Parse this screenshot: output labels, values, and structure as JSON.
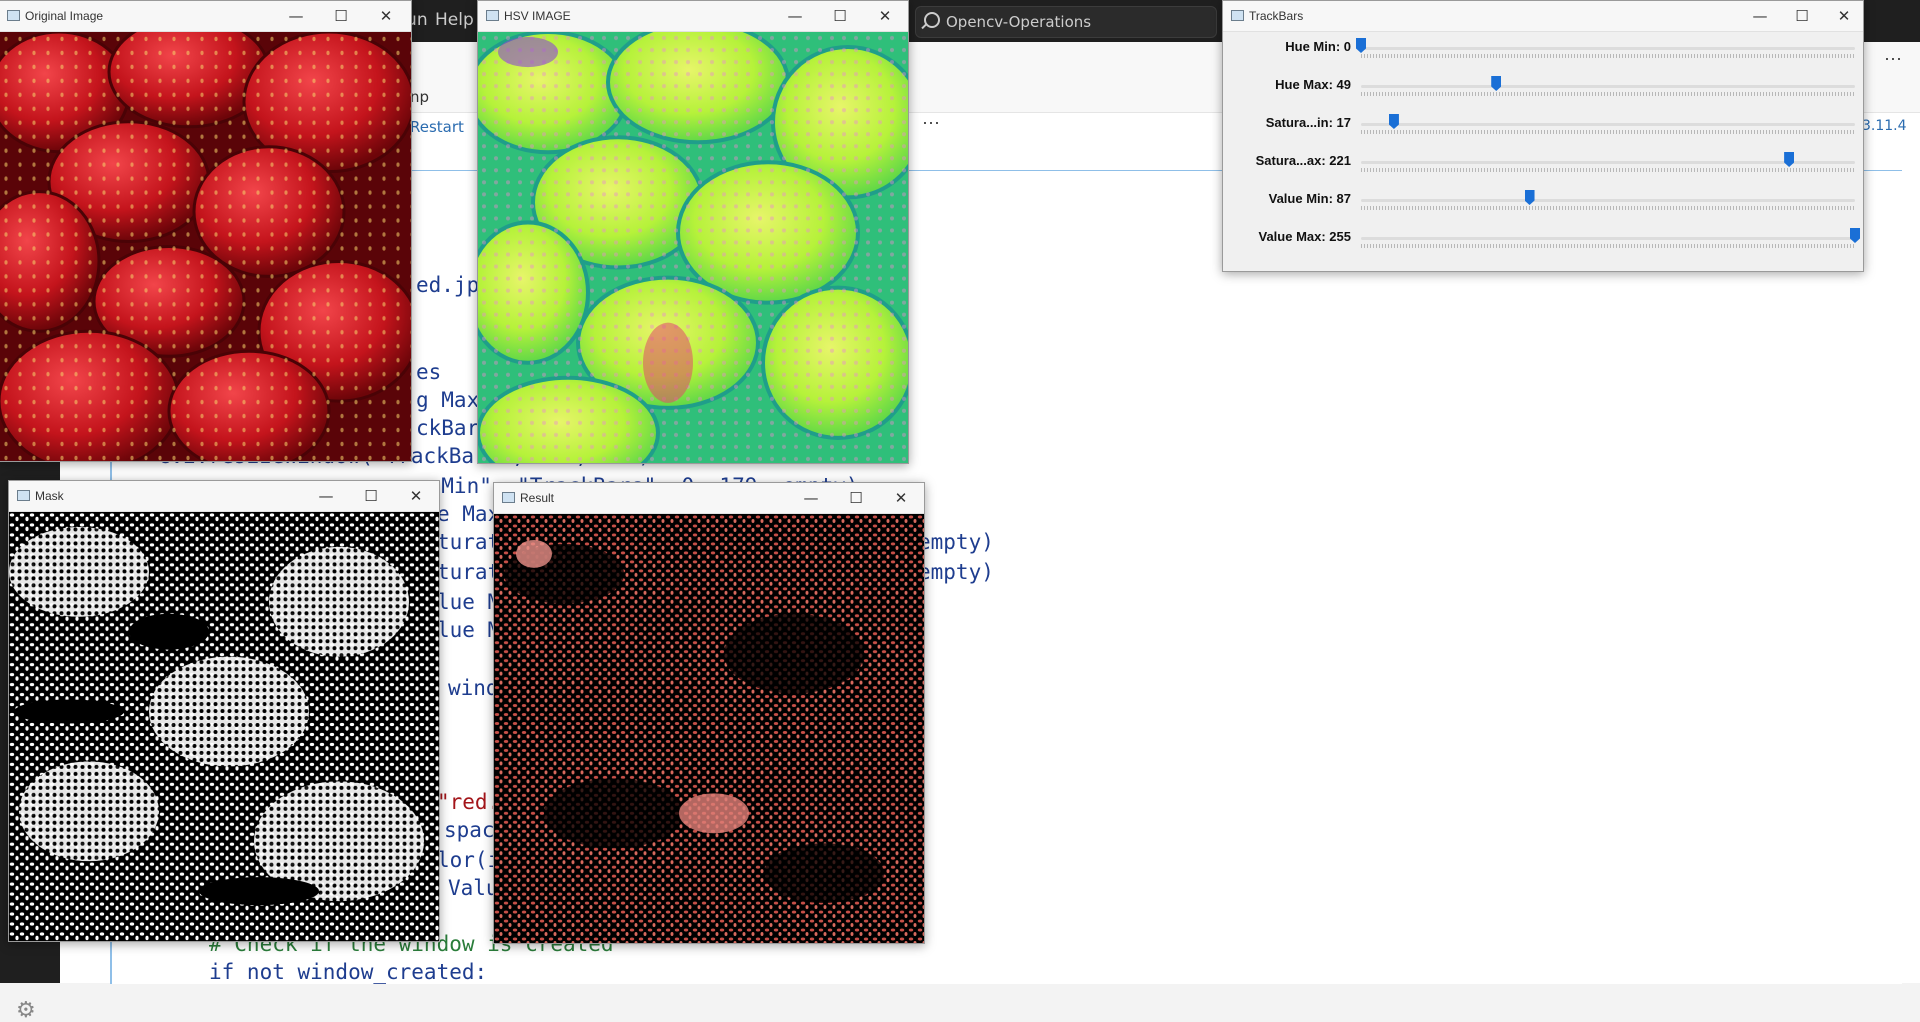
{
  "vscode": {
    "menu_run": "Run",
    "menu_help": "Help",
    "search": "Opencv-Operations",
    "breadcrumb_tail": "np",
    "restart": "Restart",
    "more": "···",
    "kernel": "3.11.4",
    "code_lines": [
      "ed.jp",
      "es",
      "g Max",
      "ckBar",
      "cv2.resizeWindow(\"TrackBars\", 640, 240)",
      "e Min\", \"TrackBars\", 0, 179, empty)",
      "e Max",
      "turat",
      "empty)",
      "turat",
      "empty)",
      "lue M",
      "lue M",
      "wind",
      "\"red.",
      "spac",
      "lor(i",
      "Valu",
      "# Check if the window is created",
      "if not window_created:"
    ]
  },
  "windows": {
    "original": {
      "title": "Original Image"
    },
    "hsv": {
      "title": "HSV IMAGE"
    },
    "mask": {
      "title": "Mask"
    },
    "result": {
      "title": "Result"
    },
    "trackbars": {
      "title": "TrackBars",
      "bars": [
        {
          "label": "Hue Min: 0",
          "value": 0,
          "max": 179
        },
        {
          "label": "Hue Max: 49",
          "value": 49,
          "max": 179
        },
        {
          "label": "Satura...in: 17",
          "value": 17,
          "max": 255
        },
        {
          "label": "Satura...ax: 221",
          "value": 221,
          "max": 255
        },
        {
          "label": "Value Min: 87",
          "value": 87,
          "max": 255
        },
        {
          "label": "Value Max: 255",
          "value": 255,
          "max": 255
        }
      ]
    }
  },
  "window_controls": {
    "minimize": "—",
    "maximize": "☐",
    "close": "✕"
  },
  "colors": {
    "strawberry_red": "#c4141c",
    "hsv_green": "#b6f23a",
    "hsv_pink": "#e88ad0",
    "mask_white": "#ffffff",
    "result_red": "#c85048",
    "trackbar_thumb": "#1a6fd6"
  }
}
